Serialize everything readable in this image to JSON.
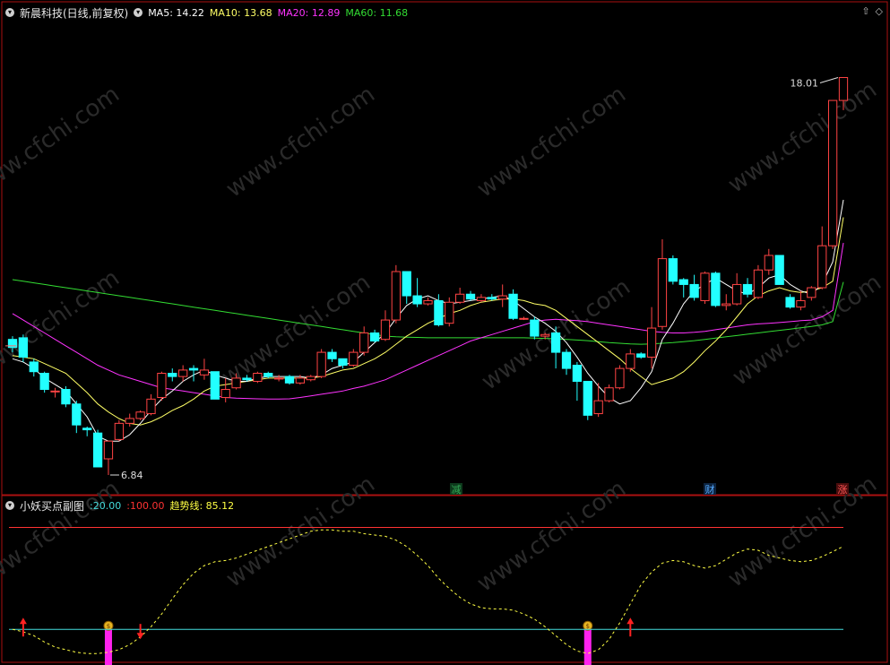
{
  "header": {
    "title": "新晨科技(日线,前复权)",
    "indicators": [
      {
        "label": "MA5:",
        "value": "14.22",
        "color": "#ffffff"
      },
      {
        "label": "MA10:",
        "value": "13.68",
        "color": "#ffff66"
      },
      {
        "label": "MA20:",
        "value": "12.89",
        "color": "#ff33ff"
      },
      {
        "label": "MA60:",
        "value": "11.68",
        "color": "#33dd33"
      }
    ]
  },
  "sub_header": {
    "title": "小妖买点副图",
    "items": [
      {
        "label": ":",
        "value": "20.00",
        "color": "#44dddd"
      },
      {
        "label": ":",
        "value": "100.00",
        "color": "#ff3333"
      },
      {
        "label": "趋势线:",
        "value": "85.12",
        "color": "#ffff44"
      }
    ]
  },
  "annotations": {
    "high": "18.01",
    "low": "6.84"
  },
  "markers": [
    {
      "text": "减",
      "color": "#33aa55",
      "bg": "#0d3a1c"
    },
    {
      "text": "财",
      "color": "#55aaff",
      "bg": "#0d2440"
    },
    {
      "text": "涨",
      "color": "#ff5555",
      "bg": "#4a0d0d"
    }
  ],
  "watermark": "www.cfchi.com",
  "colors": {
    "up": "#ff4444",
    "down": "#22ffff",
    "ma5": "#ffffff",
    "ma10": "#ffff66",
    "ma20": "#ff33ff",
    "ma60": "#33dd33",
    "border": "#aa1111"
  },
  "chart_data": [
    {
      "type": "candlestick",
      "title": "新晨科技(日线,前复权)",
      "ylim": [
        5.7,
        19.8
      ],
      "candles": [
        [
          9.9,
          9.65,
          10.0,
          9.5
        ],
        [
          9.95,
          9.35,
          10.05,
          9.2
        ],
        [
          9.2,
          8.9,
          9.3,
          8.75
        ],
        [
          8.85,
          8.35,
          8.9,
          8.25
        ],
        [
          8.3,
          8.3,
          8.4,
          8.1
        ],
        [
          8.35,
          7.9,
          8.45,
          7.8
        ],
        [
          7.9,
          7.25,
          8.0,
          7.0
        ],
        [
          7.15,
          7.1,
          7.2,
          6.9
        ],
        [
          7.0,
          5.95,
          7.1,
          6.4
        ],
        [
          6.2,
          6.75,
          6.3,
          5.7
        ],
        [
          6.8,
          7.3,
          7.4,
          6.75
        ],
        [
          7.3,
          7.45,
          7.6,
          7.2
        ],
        [
          7.45,
          7.65,
          7.7,
          7.4
        ],
        [
          7.6,
          8.05,
          8.2,
          7.55
        ],
        [
          8.1,
          8.85,
          8.9,
          8.0
        ],
        [
          8.85,
          8.75,
          9.0,
          8.6
        ],
        [
          8.75,
          8.95,
          9.1,
          8.6
        ],
        [
          9.0,
          8.95,
          9.1,
          8.6
        ],
        [
          8.8,
          8.95,
          9.3,
          8.65
        ],
        [
          8.9,
          8.05,
          8.1,
          8.8
        ],
        [
          8.1,
          8.35,
          8.7,
          7.95
        ],
        [
          8.4,
          8.7,
          8.85,
          8.35
        ],
        [
          8.7,
          8.65,
          8.8,
          8.6
        ],
        [
          8.6,
          8.85,
          8.9,
          8.55
        ],
        [
          8.85,
          8.75,
          8.9,
          8.7
        ],
        [
          8.7,
          8.7,
          8.8,
          8.6
        ],
        [
          8.75,
          8.55,
          8.8,
          8.5
        ],
        [
          8.55,
          8.7,
          8.8,
          8.5
        ],
        [
          8.65,
          8.75,
          8.8,
          8.6
        ],
        [
          8.75,
          9.5,
          9.6,
          8.7
        ],
        [
          9.5,
          9.3,
          9.6,
          9.2
        ],
        [
          9.3,
          9.1,
          9.2,
          9.0
        ],
        [
          9.1,
          9.5,
          9.6,
          9.05
        ],
        [
          9.5,
          10.1,
          10.3,
          9.4
        ],
        [
          10.1,
          9.85,
          10.2,
          9.8
        ],
        [
          9.9,
          10.5,
          10.8,
          9.85
        ],
        [
          10.5,
          12.0,
          12.2,
          10.4
        ],
        [
          12.0,
          11.25,
          11.6,
          11.0
        ],
        [
          11.25,
          11.0,
          11.8,
          10.9
        ],
        [
          11.0,
          11.1,
          11.2,
          10.95
        ],
        [
          11.1,
          10.35,
          11.3,
          10.3
        ],
        [
          10.4,
          11.05,
          11.2,
          10.3
        ],
        [
          11.05,
          11.3,
          11.5,
          11.0
        ],
        [
          11.3,
          11.15,
          11.4,
          11.1
        ],
        [
          11.1,
          11.2,
          11.3,
          11.05
        ],
        [
          11.2,
          11.15,
          11.3,
          11.1
        ],
        [
          11.15,
          11.25,
          11.6,
          10.9
        ],
        [
          11.3,
          10.55,
          11.45,
          10.5
        ],
        [
          10.55,
          10.55,
          10.6,
          10.5
        ],
        [
          10.5,
          10.0,
          10.6,
          9.9
        ],
        [
          10.0,
          10.05,
          10.1,
          9.9
        ],
        [
          10.1,
          9.5,
          10.3,
          9.0
        ],
        [
          9.5,
          9.0,
          9.6,
          8.8
        ],
        [
          9.1,
          8.6,
          9.2,
          8.0
        ],
        [
          8.6,
          7.55,
          8.6,
          7.4
        ],
        [
          7.6,
          8.0,
          8.55,
          7.5
        ],
        [
          8.0,
          8.4,
          8.5,
          7.95
        ],
        [
          8.4,
          9.0,
          9.1,
          8.35
        ],
        [
          9.0,
          9.45,
          9.6,
          8.9
        ],
        [
          9.45,
          9.35,
          9.5,
          9.3
        ],
        [
          9.35,
          10.25,
          10.9,
          9.0
        ],
        [
          10.3,
          12.4,
          13.0,
          10.2
        ],
        [
          12.4,
          11.7,
          12.5,
          11.6
        ],
        [
          11.75,
          11.6,
          11.8,
          11.2
        ],
        [
          11.6,
          11.2,
          11.9,
          11.1
        ],
        [
          11.1,
          11.95,
          12.0,
          11.0
        ],
        [
          11.95,
          10.95,
          12.0,
          10.9
        ],
        [
          10.95,
          11.0,
          11.3,
          10.8
        ],
        [
          11.0,
          11.6,
          11.95,
          10.95
        ],
        [
          11.6,
          11.3,
          11.8,
          11.2
        ],
        [
          11.2,
          12.05,
          12.2,
          11.15
        ],
        [
          12.05,
          12.5,
          12.7,
          11.9
        ],
        [
          12.5,
          11.6,
          12.4,
          11.6
        ],
        [
          11.2,
          10.9,
          11.3,
          10.85
        ],
        [
          10.9,
          11.1,
          11.4,
          10.8
        ],
        [
          11.2,
          11.5,
          11.55,
          11.1
        ],
        [
          11.5,
          12.8,
          13.4,
          11.45
        ],
        [
          12.8,
          17.3,
          17.3,
          12.7
        ],
        [
          17.3,
          18.01,
          18.01,
          17.0
        ]
      ],
      "lines": [
        {
          "name": "MA5",
          "values": [
            9.3,
            9.2,
            9.0,
            8.7,
            8.5,
            8.3,
            7.9,
            7.5,
            6.9,
            6.75,
            6.75,
            6.95,
            7.3,
            7.7,
            8.05,
            8.3,
            8.6,
            8.8,
            8.95,
            8.8,
            8.7,
            8.6,
            8.6,
            8.7,
            8.75,
            8.75,
            8.75,
            8.75,
            8.7,
            8.8,
            9.0,
            9.1,
            9.2,
            9.5,
            9.8,
            10.1,
            10.55,
            10.95,
            11.15,
            11.25,
            11.1,
            11.0,
            11.05,
            11.1,
            11.15,
            11.2,
            11.25,
            11.1,
            10.85,
            10.6,
            10.4,
            10.15,
            9.8,
            9.35,
            8.85,
            8.45,
            8.1,
            7.9,
            8.0,
            8.4,
            8.9,
            9.9,
            10.4,
            11.0,
            11.4,
            11.6,
            11.8,
            11.6,
            11.4,
            11.3,
            11.5,
            11.8,
            11.9,
            11.6,
            11.4,
            11.3,
            11.6,
            12.3,
            14.22
          ]
        },
        {
          "name": "MA10",
          "values": [
            9.4,
            9.35,
            9.3,
            9.15,
            9.0,
            8.85,
            8.55,
            8.25,
            7.9,
            7.65,
            7.45,
            7.3,
            7.25,
            7.35,
            7.5,
            7.7,
            7.85,
            8.05,
            8.3,
            8.45,
            8.5,
            8.55,
            8.6,
            8.65,
            8.7,
            8.7,
            8.7,
            8.7,
            8.7,
            8.75,
            8.85,
            8.95,
            9.0,
            9.15,
            9.3,
            9.5,
            9.75,
            10.0,
            10.2,
            10.4,
            10.55,
            10.7,
            10.8,
            10.95,
            11.05,
            11.1,
            11.15,
            11.15,
            11.1,
            11.0,
            10.95,
            10.8,
            10.55,
            10.3,
            10.05,
            9.8,
            9.55,
            9.3,
            9.0,
            8.75,
            8.5,
            8.6,
            8.7,
            8.9,
            9.2,
            9.55,
            9.85,
            10.2,
            10.6,
            11.0,
            11.25,
            11.4,
            11.5,
            11.4,
            11.35,
            11.4,
            11.5,
            11.7,
            13.68
          ]
        },
        {
          "name": "MA20",
          "values": [
            10.7,
            10.5,
            10.3,
            10.1,
            9.9,
            9.7,
            9.5,
            9.3,
            9.1,
            8.95,
            8.8,
            8.7,
            8.6,
            8.5,
            8.4,
            8.35,
            8.3,
            8.25,
            8.2,
            8.15,
            8.1,
            8.08,
            8.07,
            8.06,
            8.05,
            8.05,
            8.06,
            8.1,
            8.15,
            8.2,
            8.25,
            8.3,
            8.38,
            8.45,
            8.55,
            8.65,
            8.8,
            8.95,
            9.1,
            9.25,
            9.4,
            9.55,
            9.7,
            9.85,
            9.95,
            10.05,
            10.15,
            10.25,
            10.35,
            10.45,
            10.5,
            10.52,
            10.5,
            10.48,
            10.45,
            10.4,
            10.35,
            10.3,
            10.25,
            10.2,
            10.15,
            10.12,
            10.1,
            10.1,
            10.12,
            10.15,
            10.2,
            10.25,
            10.3,
            10.35,
            10.38,
            10.4,
            10.42,
            10.45,
            10.48,
            10.5,
            10.6,
            10.8,
            12.89
          ]
        },
        {
          "name": "MA60",
          "values": [
            11.75,
            11.7,
            11.65,
            11.6,
            11.55,
            11.5,
            11.45,
            11.4,
            11.35,
            11.3,
            11.25,
            11.2,
            11.15,
            11.1,
            11.05,
            11.0,
            10.95,
            10.9,
            10.85,
            10.8,
            10.75,
            10.7,
            10.65,
            10.6,
            10.55,
            10.5,
            10.45,
            10.4,
            10.35,
            10.3,
            10.25,
            10.2,
            10.15,
            10.1,
            10.05,
            10.0,
            9.98,
            9.97,
            9.96,
            9.95,
            9.95,
            9.95,
            9.95,
            9.95,
            9.95,
            9.95,
            9.95,
            9.95,
            9.95,
            9.94,
            9.93,
            9.92,
            9.9,
            9.88,
            9.86,
            9.83,
            9.8,
            9.78,
            9.76,
            9.75,
            9.76,
            9.78,
            9.8,
            9.83,
            9.86,
            9.9,
            9.94,
            9.98,
            10.02,
            10.06,
            10.1,
            10.14,
            10.18,
            10.22,
            10.26,
            10.3,
            10.35,
            10.45,
            11.68
          ]
        }
      ]
    },
    {
      "type": "line",
      "title": "小妖买点副图",
      "ylim": [
        -8,
        120
      ],
      "reference_lines": [
        20.0,
        100.0
      ],
      "series": [
        {
          "name": "趋势线",
          "values": [
            20,
            18,
            15,
            10,
            6,
            4,
            2,
            1,
            1,
            2,
            4,
            8,
            14,
            22,
            32,
            44,
            55,
            64,
            70,
            73,
            74,
            76,
            79,
            82,
            85,
            88,
            91,
            94,
            97,
            98,
            98,
            97,
            97,
            95,
            94,
            93,
            90,
            85,
            78,
            70,
            60,
            52,
            45,
            40,
            37,
            36,
            36,
            35,
            32,
            28,
            22,
            15,
            8,
            3,
            1,
            4,
            12,
            25,
            40,
            55,
            65,
            72,
            74,
            73,
            70,
            68,
            70,
            75,
            80,
            83,
            82,
            78,
            76,
            74,
            73,
            74,
            77,
            81,
            85.12
          ]
        }
      ],
      "buy_bars": [
        {
          "index": 9,
          "value": 20
        },
        {
          "index": 54,
          "value": 20
        }
      ],
      "arrows": [
        {
          "index": 1,
          "dir": "up"
        },
        {
          "index": 12,
          "dir": "down"
        },
        {
          "index": 58,
          "dir": "up"
        }
      ]
    }
  ]
}
